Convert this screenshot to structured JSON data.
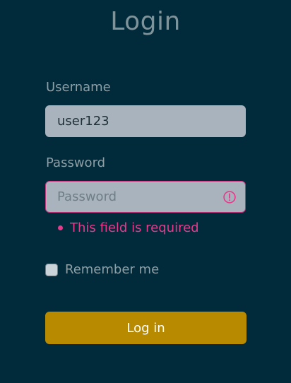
{
  "page": {
    "title": "Login"
  },
  "form": {
    "username": {
      "label": "Username",
      "value": "user123"
    },
    "password": {
      "label": "Password",
      "placeholder": "Password",
      "value": "",
      "error": "This field is required",
      "error_icon": "alert-circle-icon"
    },
    "remember": {
      "label": "Remember me",
      "checked": false
    },
    "submit_label": "Log in"
  },
  "colors": {
    "background": "#012a3a",
    "input_bg": "#a9b3bd",
    "error": "#e83a8b",
    "error_border": "#c7327c",
    "primary_button": "#b88a00"
  }
}
